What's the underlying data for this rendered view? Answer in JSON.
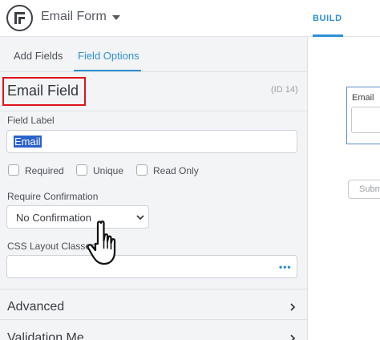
{
  "header": {
    "form_title": "Email Form",
    "build_tab": "BUILD",
    "accent_color": "#2d8fd1"
  },
  "sidebar": {
    "tabs": [
      {
        "label": "Add Fields",
        "active": false
      },
      {
        "label": "Field Options",
        "active": true
      }
    ],
    "field_name": "Email Field",
    "field_id": "(ID 14)",
    "field_label_caption": "Field Label",
    "field_label_value": "Email",
    "checkboxes": [
      {
        "label": "Required",
        "checked": false
      },
      {
        "label": "Unique",
        "checked": false
      },
      {
        "label": "Read Only",
        "checked": false
      }
    ],
    "require_confirmation_caption": "Require Confirmation",
    "require_confirmation_value": "No Confirmation",
    "css_classes_caption": "CSS Layout Classes",
    "css_classes_value": "",
    "css_options_icon": "ellipsis-icon",
    "sections": [
      {
        "label": "Advanced"
      },
      {
        "label": "Validation Me"
      }
    ]
  },
  "preview": {
    "field_label": "Email",
    "submit_label": "Subm"
  },
  "highlight_color": "#e0141b"
}
